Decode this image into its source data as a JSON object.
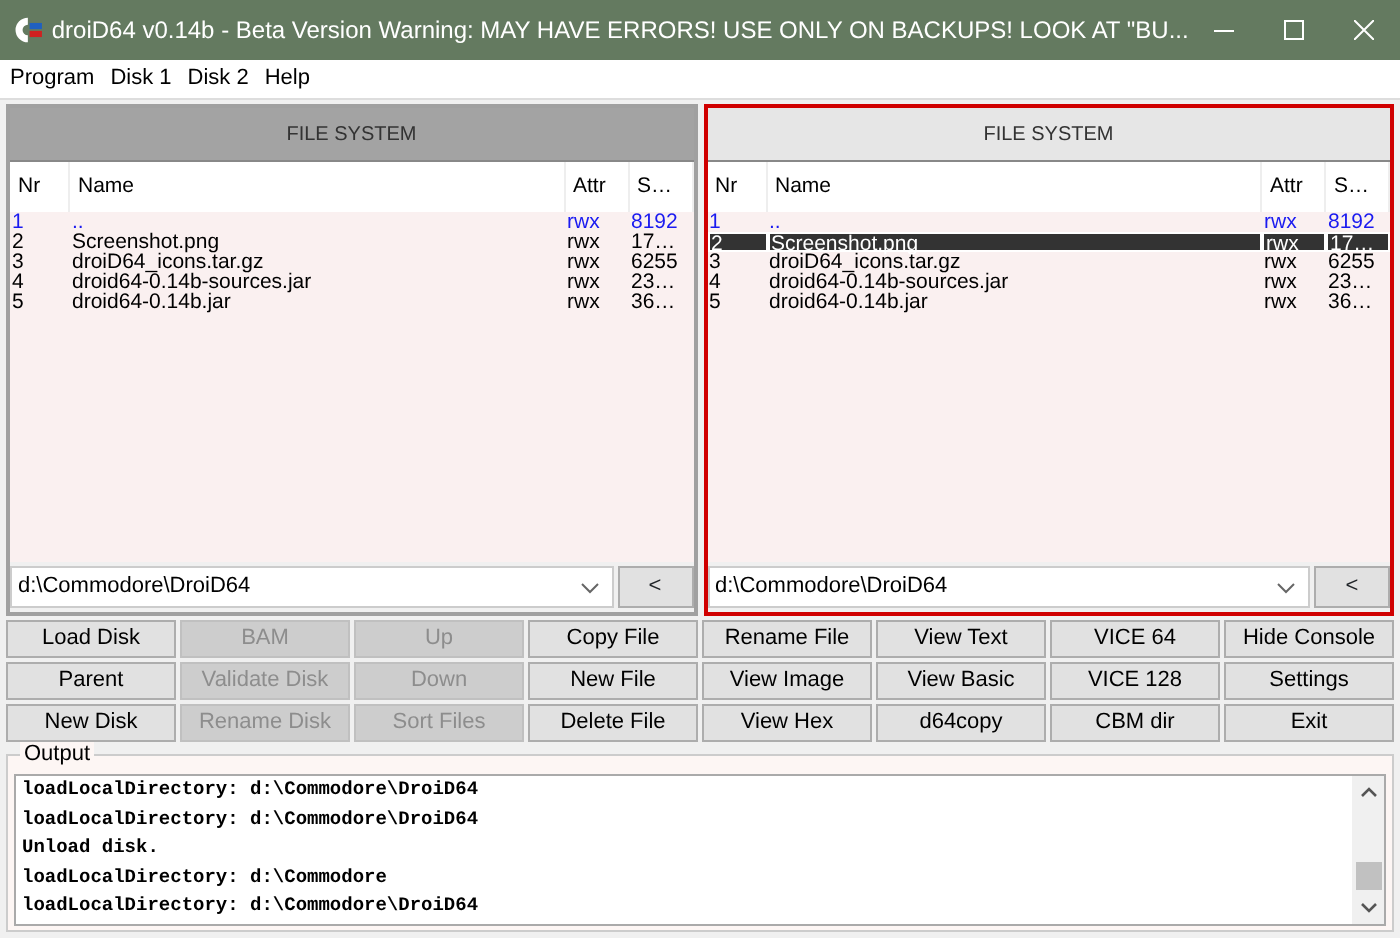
{
  "window": {
    "title": "droiD64 v0.14b - Beta Version Warning: MAY HAVE ERRORS! USE ONLY ON BACKUPS! LOOK AT \"BU..."
  },
  "menu": [
    {
      "label": "Program"
    },
    {
      "label": "Disk 1"
    },
    {
      "label": "Disk 2"
    },
    {
      "label": "Help"
    }
  ],
  "panels": [
    {
      "title": "FILE SYSTEM",
      "focused": false,
      "columns": [
        "Nr",
        "Name",
        "Attr",
        "S…"
      ],
      "path": "d:\\Commodore\\DroiD64",
      "back_button": "<",
      "rows": [
        {
          "kind": "parent",
          "selected": false,
          "cells": [
            "1",
            "..",
            "rwx",
            "8192"
          ]
        },
        {
          "kind": "file",
          "selected": false,
          "cells": [
            "2",
            "Screenshot.png",
            "rwx",
            "17…"
          ]
        },
        {
          "kind": "file",
          "selected": false,
          "cells": [
            "3",
            "droiD64_icons.tar.gz",
            "rwx",
            "6255"
          ]
        },
        {
          "kind": "file",
          "selected": false,
          "cells": [
            "4",
            "droid64-0.14b-sources.jar",
            "rwx",
            "23…"
          ]
        },
        {
          "kind": "file",
          "selected": false,
          "cells": [
            "5",
            "droid64-0.14b.jar",
            "rwx",
            "36…"
          ]
        }
      ]
    },
    {
      "title": "FILE SYSTEM",
      "focused": true,
      "columns": [
        "Nr",
        "Name",
        "Attr",
        "S…"
      ],
      "path": "d:\\Commodore\\DroiD64",
      "back_button": "<",
      "rows": [
        {
          "kind": "parent",
          "selected": false,
          "cells": [
            "1",
            "..",
            "rwx",
            "8192"
          ]
        },
        {
          "kind": "file",
          "selected": true,
          "cells": [
            "2",
            "Screenshot.png",
            "rwx",
            "17…"
          ]
        },
        {
          "kind": "file",
          "selected": false,
          "cells": [
            "3",
            "droiD64_icons.tar.gz",
            "rwx",
            "6255"
          ]
        },
        {
          "kind": "file",
          "selected": false,
          "cells": [
            "4",
            "droid64-0.14b-sources.jar",
            "rwx",
            "23…"
          ]
        },
        {
          "kind": "file",
          "selected": false,
          "cells": [
            "5",
            "droid64-0.14b.jar",
            "rwx",
            "36…"
          ]
        }
      ]
    }
  ],
  "buttons": [
    {
      "label": "Load Disk",
      "disabled": false
    },
    {
      "label": "BAM",
      "disabled": true
    },
    {
      "label": "Up",
      "disabled": true
    },
    {
      "label": "Copy File",
      "disabled": false
    },
    {
      "label": "Rename File",
      "disabled": false
    },
    {
      "label": "View Text",
      "disabled": false
    },
    {
      "label": "VICE 64",
      "disabled": false
    },
    {
      "label": "Hide Console",
      "disabled": false
    },
    {
      "label": "Parent",
      "disabled": false
    },
    {
      "label": "Validate Disk",
      "disabled": true
    },
    {
      "label": "Down",
      "disabled": true
    },
    {
      "label": "New File",
      "disabled": false
    },
    {
      "label": "View Image",
      "disabled": false
    },
    {
      "label": "View Basic",
      "disabled": false
    },
    {
      "label": "VICE 128",
      "disabled": false
    },
    {
      "label": "Settings",
      "disabled": false
    },
    {
      "label": "New Disk",
      "disabled": false
    },
    {
      "label": "Rename Disk",
      "disabled": true
    },
    {
      "label": "Sort Files",
      "disabled": true
    },
    {
      "label": "Delete File",
      "disabled": false
    },
    {
      "label": "View Hex",
      "disabled": false
    },
    {
      "label": "d64copy",
      "disabled": false
    },
    {
      "label": "CBM dir",
      "disabled": false
    },
    {
      "label": "Exit",
      "disabled": false
    }
  ],
  "output": {
    "title": "Output",
    "lines": [
      "loadLocalDirectory: d:\\Commodore\\DroiD64",
      "loadLocalDirectory: d:\\Commodore\\DroiD64",
      "Unload disk.",
      "loadLocalDirectory: d:\\Commodore",
      "loadLocalDirectory: d:\\Commodore\\DroiD64"
    ]
  }
}
